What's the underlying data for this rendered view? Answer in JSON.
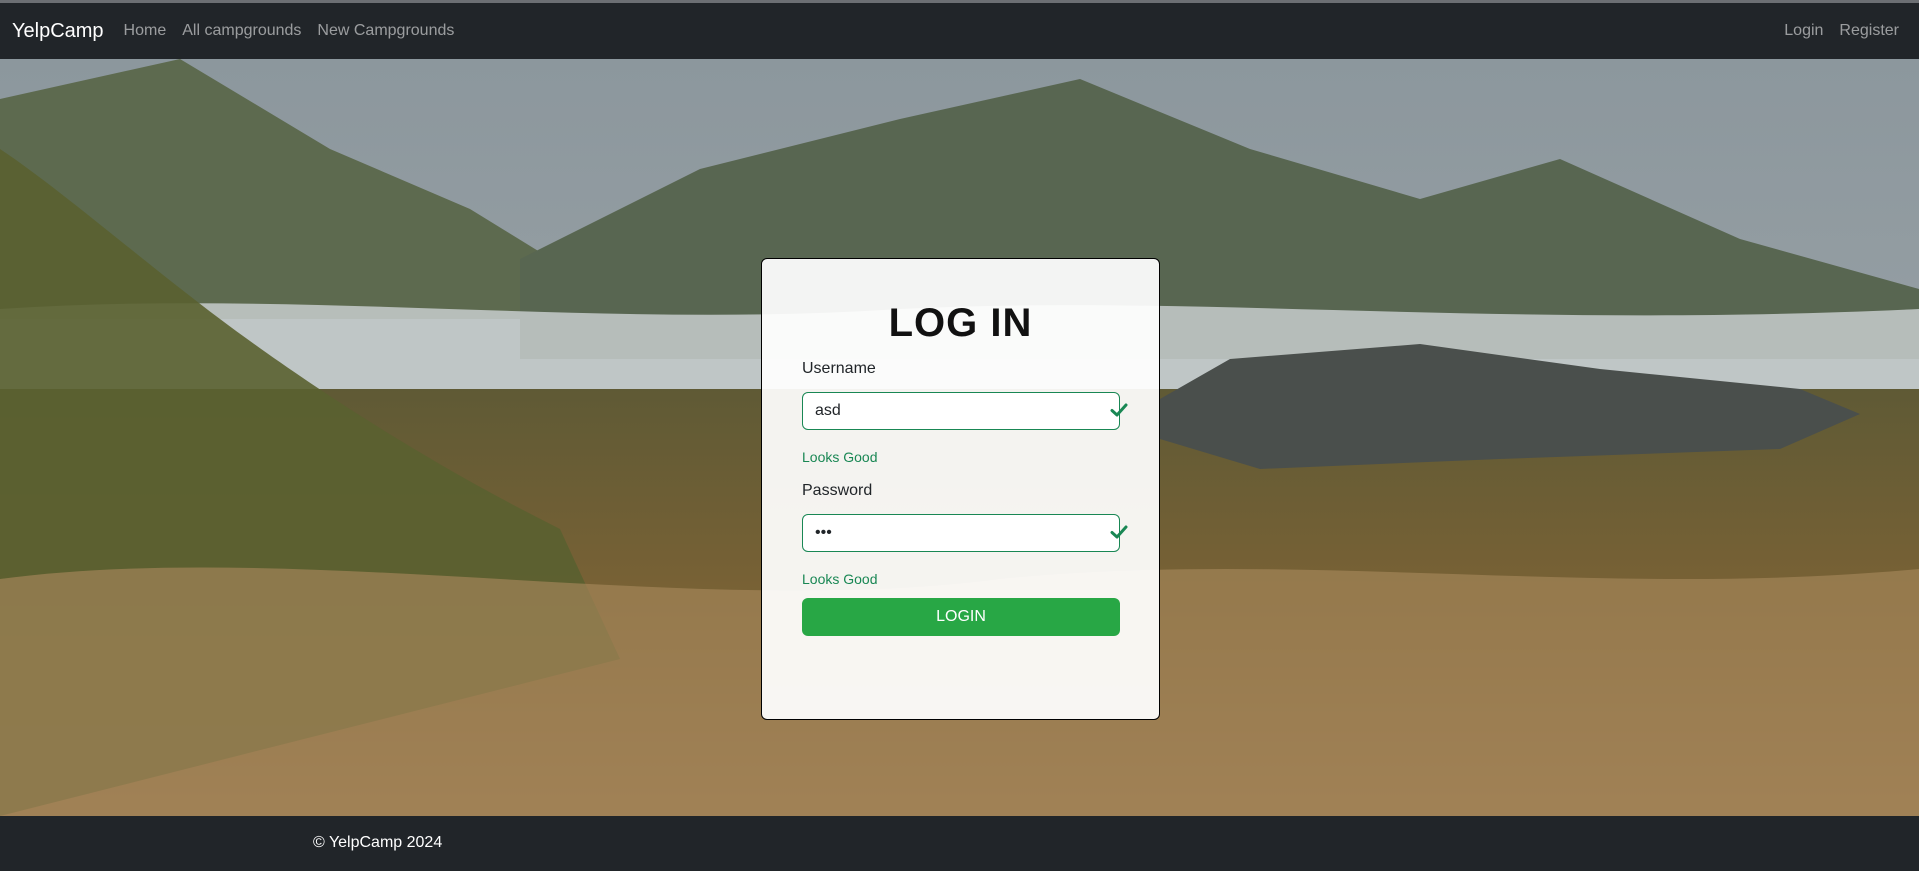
{
  "navbar": {
    "brand": "YelpCamp",
    "links": [
      "Home",
      "All campgrounds",
      "New Campgrounds"
    ],
    "right_links": [
      "Login",
      "Register"
    ]
  },
  "login_card": {
    "title": "LOG IN",
    "username_label": "Username",
    "username_value": "asd",
    "username_feedback": "Looks Good",
    "password_label": "Password",
    "password_value": "•••",
    "password_feedback": "Looks Good",
    "submit_label": "LOGIN"
  },
  "footer": {
    "text": "© YelpCamp 2024"
  },
  "colors": {
    "navbar_bg": "#212529",
    "valid_green": "#198754",
    "button_green": "#28a745"
  },
  "icons": {
    "field_valid": "checkmark-icon"
  }
}
